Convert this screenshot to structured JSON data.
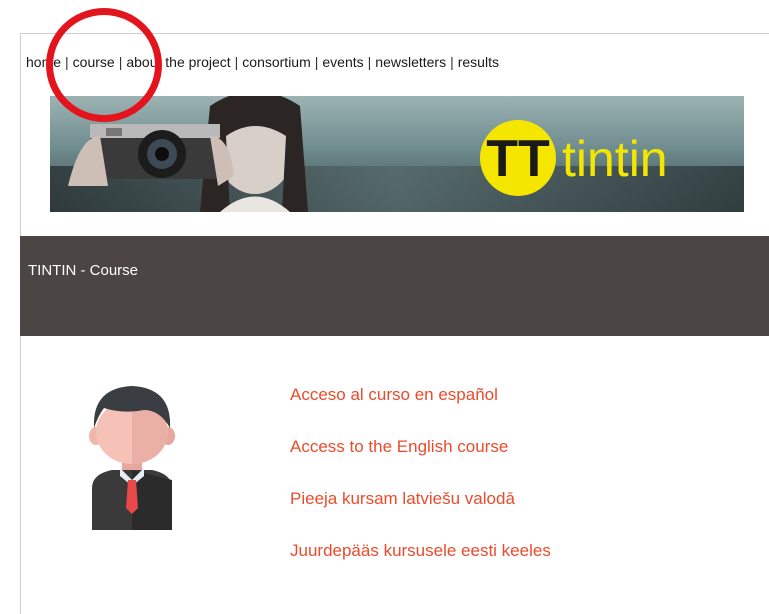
{
  "nav": {
    "items": [
      "home",
      "course",
      "about the project",
      "consortium",
      "events",
      "newsletters",
      "results"
    ],
    "separator": "|"
  },
  "banner": {
    "logo_text": "tintin",
    "logo_mark": "TT",
    "logo_color": "#f5e600"
  },
  "title_bar": {
    "title": "TINTIN - Course",
    "bg_color": "#4b4544"
  },
  "course": {
    "links": [
      "Acceso al curso en español",
      "Access to the English course",
      "Pieeja kursam latviešu valodā",
      "Juurdepääs kursusele eesti keeles"
    ],
    "link_color": "#ea4b2c"
  },
  "annotation": {
    "color": "#e3141e",
    "highlights": "course"
  }
}
